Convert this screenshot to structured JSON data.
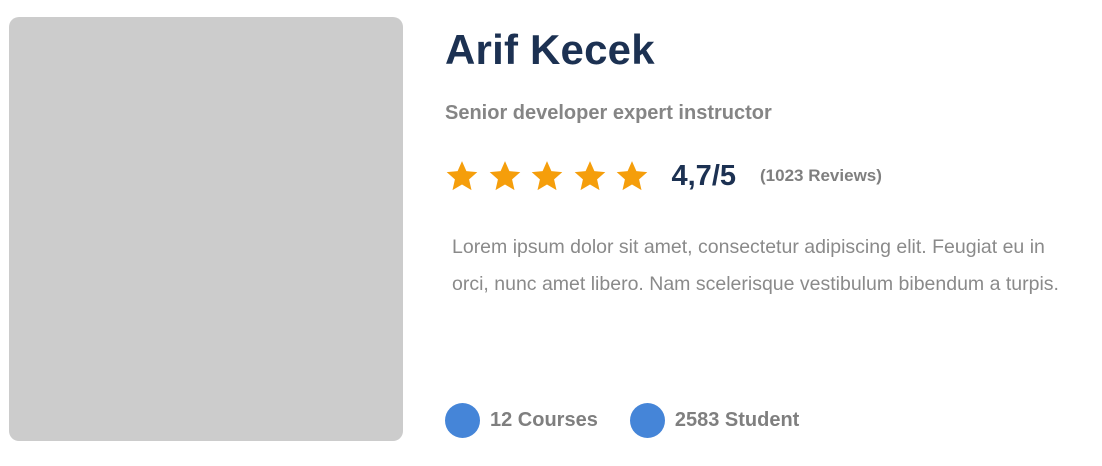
{
  "instructor": {
    "name": "Arif Kecek",
    "title": "Senior developer expert instructor",
    "rating": {
      "stars_filled": 5,
      "stars_total": 5,
      "score_text": "4,7/5",
      "reviews_text": "(1023 Reviews)"
    },
    "description": "Lorem ipsum dolor sit amet, consectetur adipiscing elit. Feugiat eu in orci, nunc amet libero. Nam scelerisque vestibulum bibendum a turpis.",
    "stats": [
      {
        "icon": "course-icon",
        "label": "12 Courses"
      },
      {
        "icon": "student-icon",
        "label": "2583 Student"
      }
    ]
  },
  "colors": {
    "name": "#1c3152",
    "star": "#f59e0b",
    "stat_dot": "#4585d8",
    "photo_placeholder": "#cccccc"
  }
}
